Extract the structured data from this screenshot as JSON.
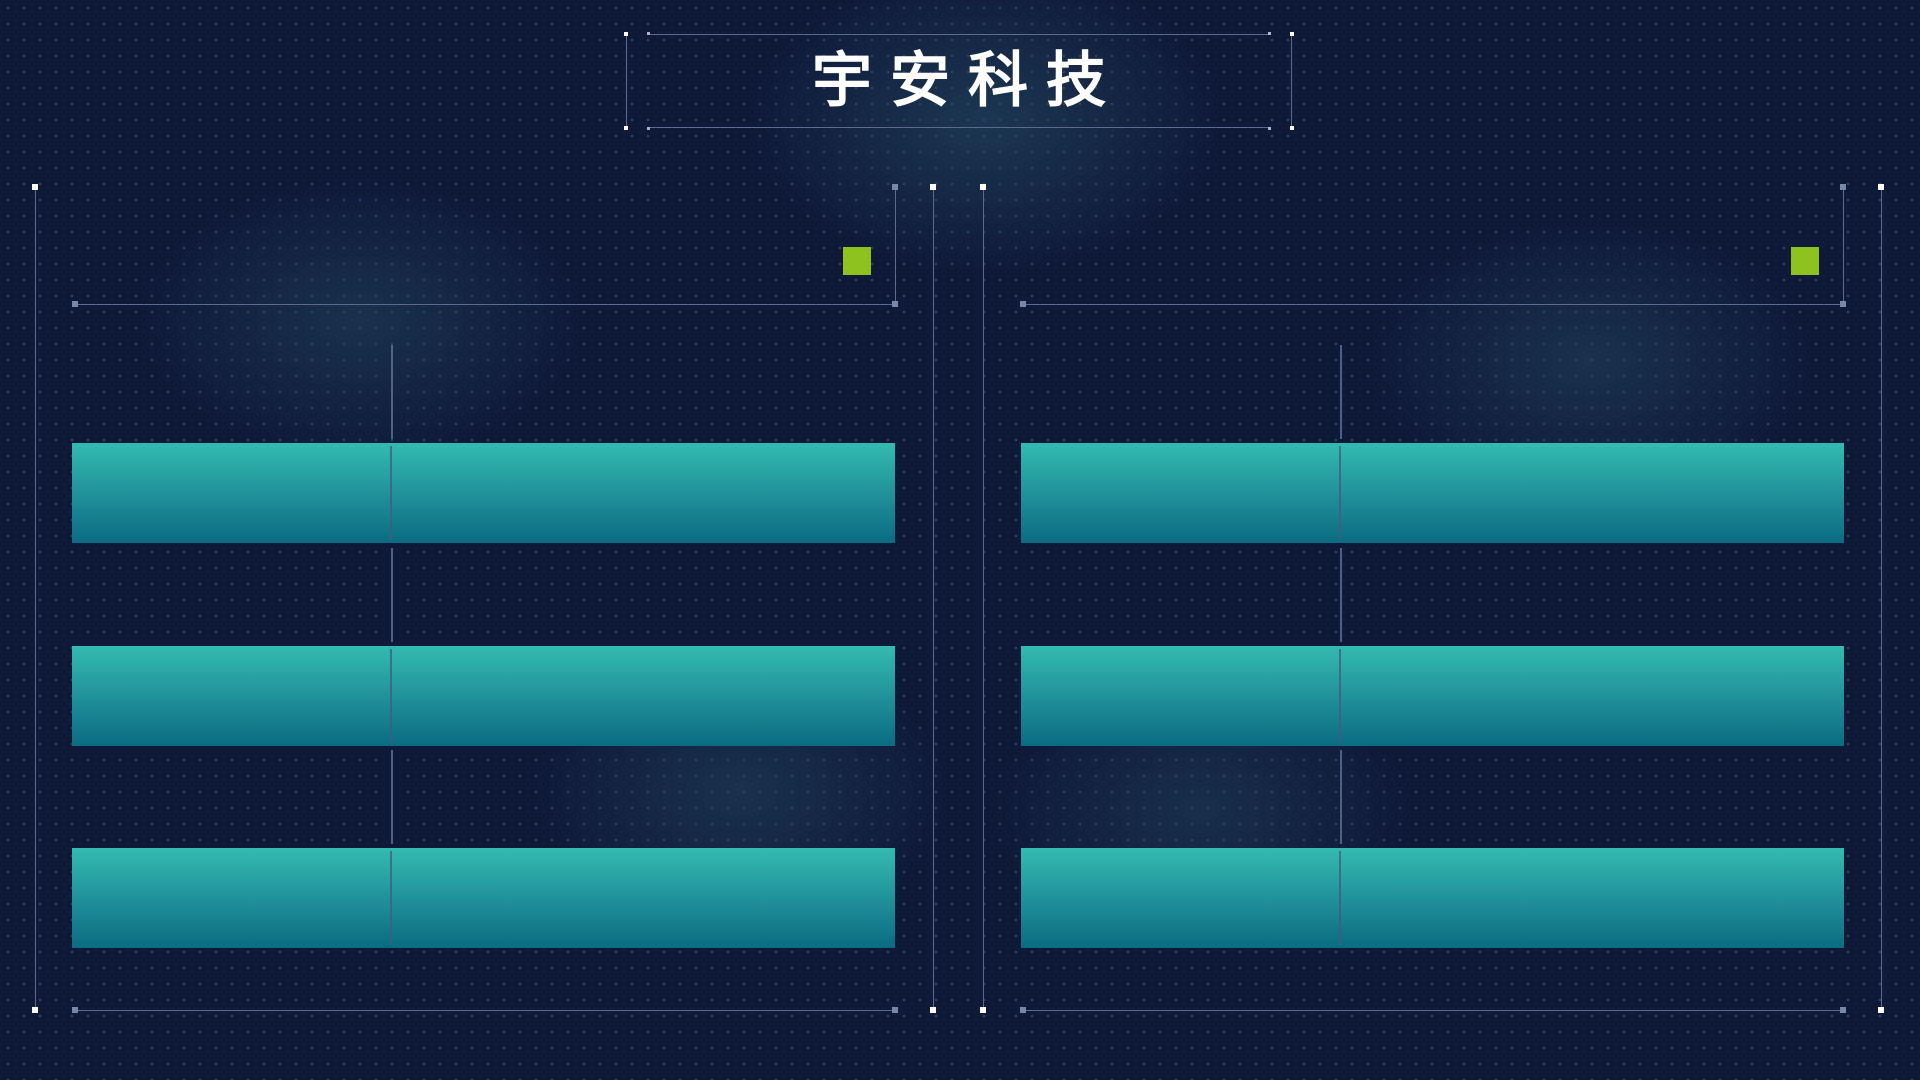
{
  "header": {
    "title": "宇安科技"
  },
  "colors": {
    "background": "#0f1938",
    "frame_line": "#5b6a8e",
    "accent_marker": "#8ec21f",
    "bar_top": "#33bbb1",
    "bar_bottom": "#0a6c82"
  },
  "panels": [
    {
      "id": "left-panel",
      "rows": 3
    },
    {
      "id": "right-panel",
      "rows": 3
    }
  ]
}
